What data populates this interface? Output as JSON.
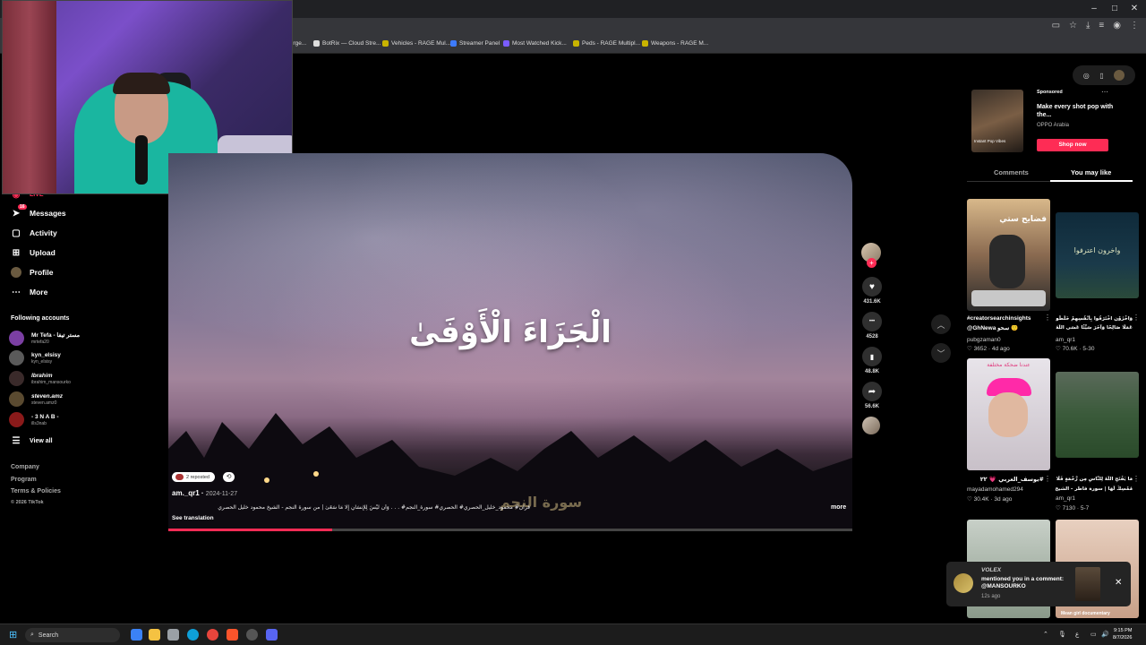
{
  "window": {
    "minimize": "–",
    "maximize": "□",
    "close": "✕"
  },
  "bookmarks": [
    {
      "label": "...rge...",
      "icon": "page-icon",
      "color": "#888888"
    },
    {
      "label": "BotRix — Cloud Stre...",
      "icon": "botrix-icon",
      "color": "#dddddd"
    },
    {
      "label": "Vehicles - RAGE Mul...",
      "icon": "rage-icon",
      "color": "#c9b400"
    },
    {
      "label": "Streamer Panel",
      "icon": "panel-icon",
      "color": "#3d7bff"
    },
    {
      "label": "Most Watched Kick...",
      "icon": "kick-icon",
      "color": "#7a5cff"
    },
    {
      "label": "Peds - RAGE Multipl...",
      "icon": "rage-icon",
      "color": "#c9b400"
    },
    {
      "label": "Weapons - RAGE M...",
      "icon": "rage-icon",
      "color": "#c9b400"
    }
  ],
  "sidebar": {
    "live_label": "LIVE",
    "items": [
      {
        "label": "Messages",
        "icon": "send-icon",
        "badge": "16"
      },
      {
        "label": "Activity",
        "icon": "inbox-icon"
      },
      {
        "label": "Upload",
        "icon": "plus-square-icon"
      },
      {
        "label": "Profile",
        "icon": "profile-avatar-icon"
      },
      {
        "label": "More",
        "icon": "more-dots-icon"
      }
    ],
    "following_title": "Following accounts",
    "accounts": [
      {
        "name": "Mr Tefa - مستر تيفا",
        "username": "mrtefa20",
        "color": "#7b3fa3"
      },
      {
        "name": "kyn_elsisy",
        "username": "kyn_elsisy",
        "color": "#5a5a5a"
      },
      {
        "name": "Ibrahim",
        "username": "ibrahim_mansourko",
        "color": "#3a2a2a"
      },
      {
        "name": "steven.amz",
        "username": "steven.amz0",
        "color": "#5a4a30"
      },
      {
        "name": "- 3 N A B -",
        "username": "ills3nab",
        "color": "#8a1a1a"
      }
    ],
    "view_all": "View all",
    "footer": [
      "Company",
      "Program",
      "Terms & Policies",
      "© 2026 TikTok"
    ]
  },
  "video": {
    "title_arabic": "الْجَزَاءَ الْأَوْفَىٰ",
    "watermark": "سورة النجم",
    "reposted": "2 reposted",
    "author": "am._qr1",
    "date": "2024-11-27",
    "caption": "قران# محمود_خليل_الحصري# الحصري# سورة_النجم# . . . وَأَن لَّيْسَ لِلْإِنسَانِ إِلَّا مَا سَعَىٰ | من سورة النجم - الشيخ محمود خليل الحصري",
    "see_translation": "See translation",
    "more": "more",
    "progress": 0.24
  },
  "actions": [
    {
      "name": "like",
      "icon": "heart-icon",
      "glyph": "♥",
      "count": "431.6K"
    },
    {
      "name": "comment",
      "icon": "comment-icon",
      "glyph": "•••",
      "count": "4528"
    },
    {
      "name": "bookmark",
      "icon": "bookmark-icon",
      "glyph": "▮",
      "count": "48.8K"
    },
    {
      "name": "share",
      "icon": "share-icon",
      "glyph": "➦",
      "count": "56.6K"
    }
  ],
  "ad": {
    "sponsored": "Sponsored",
    "title": "Make every shot pop with the...",
    "brand": "OPPO Arabia",
    "button": "Shop now",
    "thumb_caption": "Instant Pop Vibes"
  },
  "tabs": {
    "comments": "Comments",
    "you_may_like": "You may like"
  },
  "cards": [
    {
      "title": "#creatorsearchinsights",
      "subtitle": "@GhNewa سحو 🙂",
      "user": "pubgzaman0",
      "likes": "3652",
      "age": "4d ago",
      "thumb_text": "فضايح ستي"
    },
    {
      "title": "وَاخْزَوْن اخْتَرَفُوا بِأَنْفُسِهِمْ خَلَطُوا",
      "subtitle": "عَمَلًا صَالِحًا وَآخَرَ سَيِّئًا عَسَى اللَّهُ",
      "user": "am_qr1",
      "likes": "70.6K",
      "age": "5-30",
      "thumb_text": "واخرون اعترفوا"
    },
    {
      "title": "#يوسف_العربي 💗 ٢٢",
      "subtitle": "",
      "user": "mayadamohamed294",
      "likes": "30.4K",
      "age": "3d ago",
      "thumb_text": "عندنا ضحكة مختلفة"
    },
    {
      "title": "مَا يَفْتَحِ اللَّهُ لِلنَّاسِ مِن رَّحْمَةٍ فَلَا",
      "subtitle": "مُمْسِكَ لَهَا | سورة فاطر - الشيخ",
      "user": "am_qr1",
      "likes": "7130",
      "age": "5-7",
      "thumb_text": ""
    }
  ],
  "bottom_card_caption": "Mean girl documentary",
  "toast": {
    "name": "VOLEX",
    "message": "mentioned you in a comment: @MANSOURKO",
    "time": "12s ago",
    "close": "✕"
  },
  "taskbar": {
    "search": "Search",
    "tray_lang": "ع",
    "time": "9:15 PM",
    "date": "8/7/2026"
  }
}
